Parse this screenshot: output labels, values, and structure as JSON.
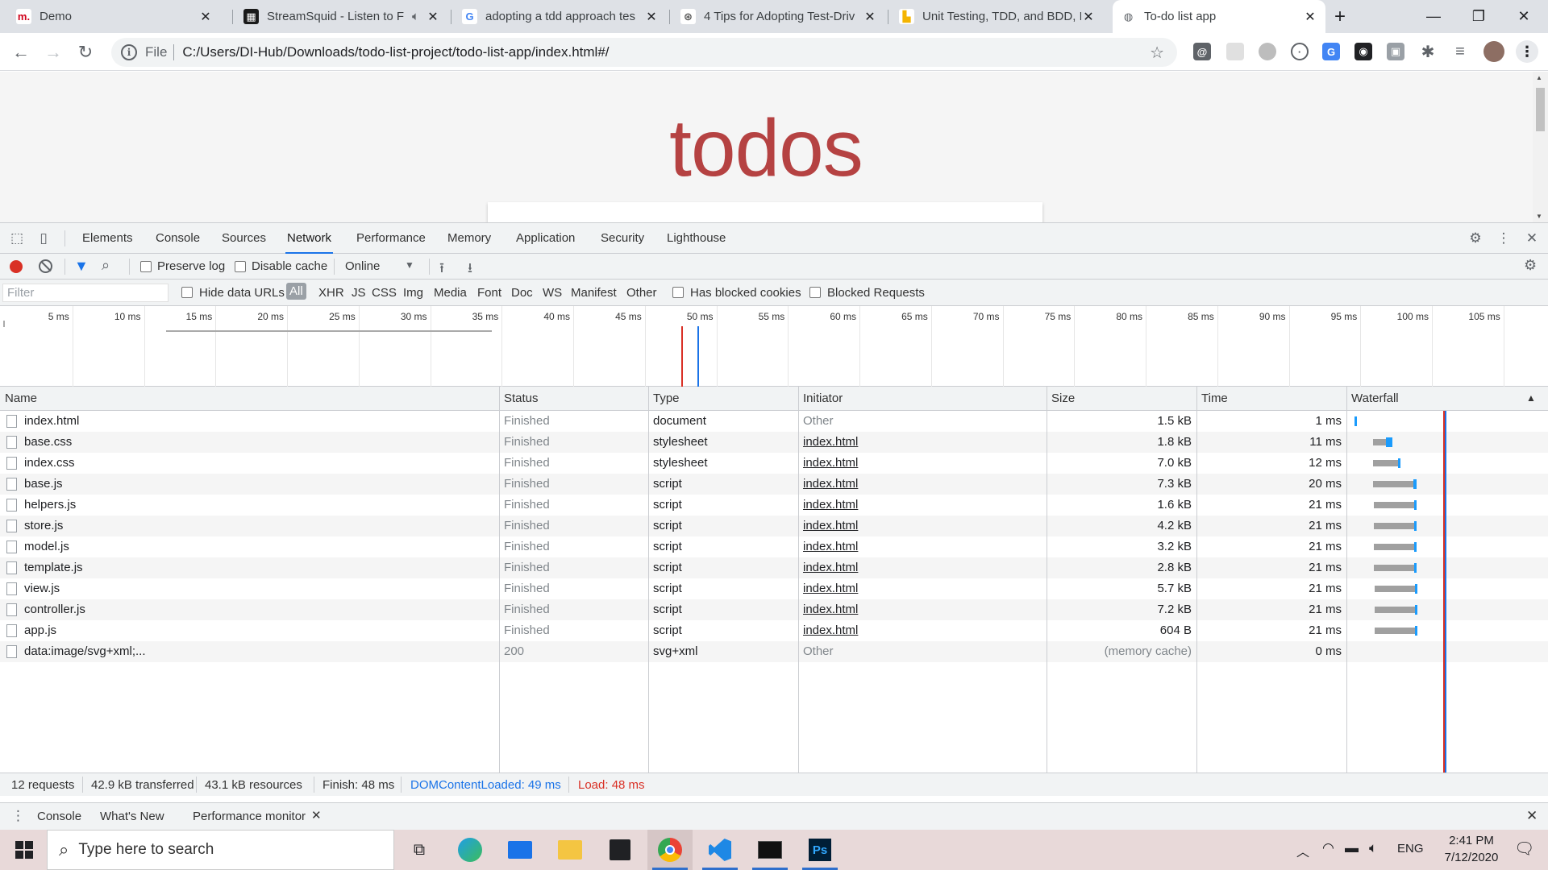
{
  "browser": {
    "tabs": [
      {
        "title": "Demo",
        "favicon": "m.",
        "favicon_bg": "#ffffff",
        "favicon_fg": "#d0021b",
        "muted_icon": false,
        "active": false
      },
      {
        "title": "StreamSquid - Listen to F",
        "favicon": "▦",
        "favicon_bg": "#1a1a1a",
        "favicon_fg": "#ffffff",
        "muted_icon": true,
        "active": false
      },
      {
        "title": "adopting a tdd approach tes",
        "favicon": "G",
        "favicon_bg": "#ffffff",
        "favicon_fg": "#4285f4",
        "muted_icon": false,
        "active": false
      },
      {
        "title": "4 Tips for Adopting Test-Driv",
        "favicon": "⊛",
        "favicon_bg": "#ffffff",
        "favicon_fg": "#555555",
        "muted_icon": false,
        "active": false
      },
      {
        "title": "Unit Testing, TDD, and BDD, I",
        "favicon": "▙",
        "favicon_bg": "#ffffff",
        "favicon_fg": "#f4b400",
        "muted_icon": false,
        "active": false
      },
      {
        "title": "To-do list app",
        "favicon": "◍",
        "favicon_bg": "#ffffff",
        "favicon_fg": "#5f6368",
        "muted_icon": false,
        "active": true
      }
    ],
    "new_tab": "+",
    "address": {
      "scheme_label": "File",
      "url": "C:/Users/DI-Hub/Downloads/todo-list-project/todo-list-app/index.html#/"
    }
  },
  "page": {
    "heading": "todos",
    "heading_color": "#af2f2f"
  },
  "devtools": {
    "tabs": [
      "Elements",
      "Console",
      "Sources",
      "Network",
      "Performance",
      "Memory",
      "Application",
      "Security",
      "Lighthouse"
    ],
    "active_tab": "Network",
    "toolbar": {
      "preserve_log": "Preserve log",
      "disable_cache": "Disable cache",
      "throttling": "Online"
    },
    "filter": {
      "placeholder": "Filter",
      "hide_data_urls": "Hide data URLs",
      "types": [
        "All",
        "XHR",
        "JS",
        "CSS",
        "Img",
        "Media",
        "Font",
        "Doc",
        "WS",
        "Manifest",
        "Other"
      ],
      "has_blocked_cookies": "Has blocked cookies",
      "blocked_requests": "Blocked Requests"
    },
    "overview_ticks": [
      "5 ms",
      "10 ms",
      "15 ms",
      "20 ms",
      "25 ms",
      "30 ms",
      "35 ms",
      "40 ms",
      "45 ms",
      "50 ms",
      "55 ms",
      "60 ms",
      "65 ms",
      "70 ms",
      "75 ms",
      "80 ms",
      "85 ms",
      "90 ms",
      "95 ms",
      "100 ms",
      "105 ms",
      "1"
    ],
    "columns": [
      "Name",
      "Status",
      "Type",
      "Initiator",
      "Size",
      "Time",
      "Waterfall"
    ],
    "requests": [
      {
        "name": "index.html",
        "status": "Finished",
        "type": "document",
        "initiator": "Other",
        "size": "1.5 kB",
        "time": "1 ms",
        "wf_start": 0,
        "wf_wait": 0.2,
        "wf_dl": 0.2
      },
      {
        "name": "base.css",
        "status": "Finished",
        "type": "stylesheet",
        "initiator": "index.html",
        "size": "1.8 kB",
        "time": "11 ms",
        "wf_start": 23,
        "wf_wait": 15,
        "wf_dl": 8
      },
      {
        "name": "index.css",
        "status": "Finished",
        "type": "stylesheet",
        "initiator": "index.html",
        "size": "7.0 kB",
        "time": "12 ms",
        "wf_start": 23,
        "wf_wait": 30,
        "wf_dl": 2
      },
      {
        "name": "base.js",
        "status": "Finished",
        "type": "script",
        "initiator": "index.html",
        "size": "7.3 kB",
        "time": "20 ms",
        "wf_start": 23,
        "wf_wait": 48,
        "wf_dl": 4
      },
      {
        "name": "helpers.js",
        "status": "Finished",
        "type": "script",
        "initiator": "index.html",
        "size": "1.6 kB",
        "time": "21 ms",
        "wf_start": 24,
        "wf_wait": 48,
        "wf_dl": 3
      },
      {
        "name": "store.js",
        "status": "Finished",
        "type": "script",
        "initiator": "index.html",
        "size": "4.2 kB",
        "time": "21 ms",
        "wf_start": 24,
        "wf_wait": 48,
        "wf_dl": 3
      },
      {
        "name": "model.js",
        "status": "Finished",
        "type": "script",
        "initiator": "index.html",
        "size": "3.2 kB",
        "time": "21 ms",
        "wf_start": 24,
        "wf_wait": 48,
        "wf_dl": 3
      },
      {
        "name": "template.js",
        "status": "Finished",
        "type": "script",
        "initiator": "index.html",
        "size": "2.8 kB",
        "time": "21 ms",
        "wf_start": 24,
        "wf_wait": 48,
        "wf_dl": 3
      },
      {
        "name": "view.js",
        "status": "Finished",
        "type": "script",
        "initiator": "index.html",
        "size": "5.7 kB",
        "time": "21 ms",
        "wf_start": 25,
        "wf_wait": 48,
        "wf_dl": 3
      },
      {
        "name": "controller.js",
        "status": "Finished",
        "type": "script",
        "initiator": "index.html",
        "size": "7.2 kB",
        "time": "21 ms",
        "wf_start": 25,
        "wf_wait": 48,
        "wf_dl": 3
      },
      {
        "name": "app.js",
        "status": "Finished",
        "type": "script",
        "initiator": "index.html",
        "size": "604 B",
        "time": "21 ms",
        "wf_start": 25,
        "wf_wait": 48,
        "wf_dl": 3
      },
      {
        "name": "data:image/svg+xml;...",
        "status": "200",
        "type": "svg+xml",
        "initiator": "Other",
        "size": "(memory cache)",
        "time": "0 ms",
        "wf_start": 0,
        "wf_wait": 0,
        "wf_dl": 0
      }
    ],
    "summary": {
      "requests": "12 requests",
      "transferred": "42.9 kB transferred",
      "resources": "43.1 kB resources",
      "finish": "Finish: 48 ms",
      "dom_content_loaded": "DOMContentLoaded: 49 ms",
      "load": "Load: 48 ms"
    },
    "drawer_tabs": [
      "Console",
      "What's New",
      "Performance monitor"
    ],
    "colors": {
      "dcl": "#1a73e8",
      "load": "#d93025",
      "record": "#d93025",
      "waiting": "#a0a0a0",
      "download": "#1a9bfc"
    }
  },
  "taskbar": {
    "search_placeholder": "Type here to search",
    "clock_time": "2:41 PM",
    "clock_date": "7/12/2020",
    "language": "ENG",
    "apps": [
      "task-view",
      "edge",
      "mail",
      "file-explorer",
      "store",
      "chrome",
      "vscode",
      "terminal",
      "photoshop"
    ]
  }
}
